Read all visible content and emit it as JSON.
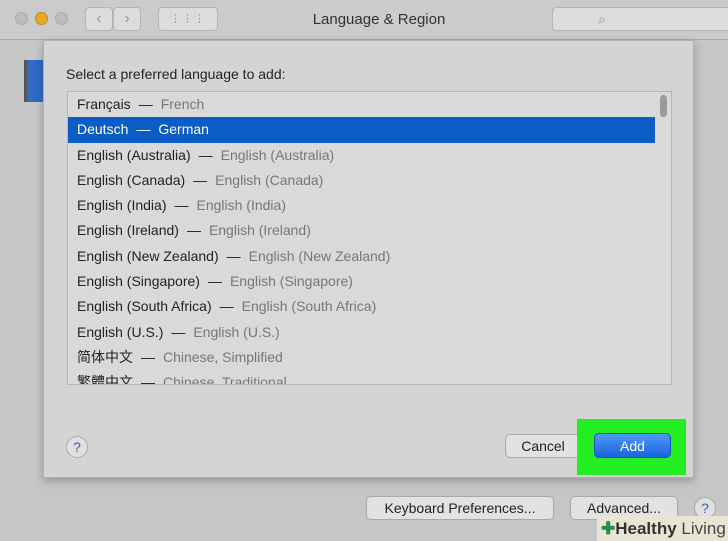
{
  "window": {
    "title": "Language & Region"
  },
  "dialog": {
    "prompt": "Select a preferred language to add:",
    "languages": [
      {
        "native": "Français",
        "english": "French"
      },
      {
        "native": "Deutsch",
        "english": "German",
        "selected": true
      },
      {
        "native": "English (Australia)",
        "english": "English (Australia)"
      },
      {
        "native": "English (Canada)",
        "english": "English (Canada)"
      },
      {
        "native": "English (India)",
        "english": "English (India)"
      },
      {
        "native": "English (Ireland)",
        "english": "English (Ireland)"
      },
      {
        "native": "English (New Zealand)",
        "english": "English (New Zealand)"
      },
      {
        "native": "English (Singapore)",
        "english": "English (Singapore)"
      },
      {
        "native": "English (South Africa)",
        "english": "English (South Africa)"
      },
      {
        "native": "English (U.S.)",
        "english": "English (U.S.)"
      },
      {
        "native": "简体中文",
        "english": "Chinese, Simplified"
      },
      {
        "native": "繁體中文",
        "english": "Chinese, Traditional"
      }
    ],
    "separator": "—",
    "cancel": "Cancel",
    "add": "Add",
    "help": "?"
  },
  "footer": {
    "keyboard": "Keyboard Preferences...",
    "advanced": "Advanced...",
    "help": "?"
  },
  "watermark": {
    "brand": "Healthy",
    "suffix": "Living"
  },
  "colors": {
    "selection": "#0b5cc4",
    "highlight": "#22ee22",
    "accent": "#1a63df"
  }
}
